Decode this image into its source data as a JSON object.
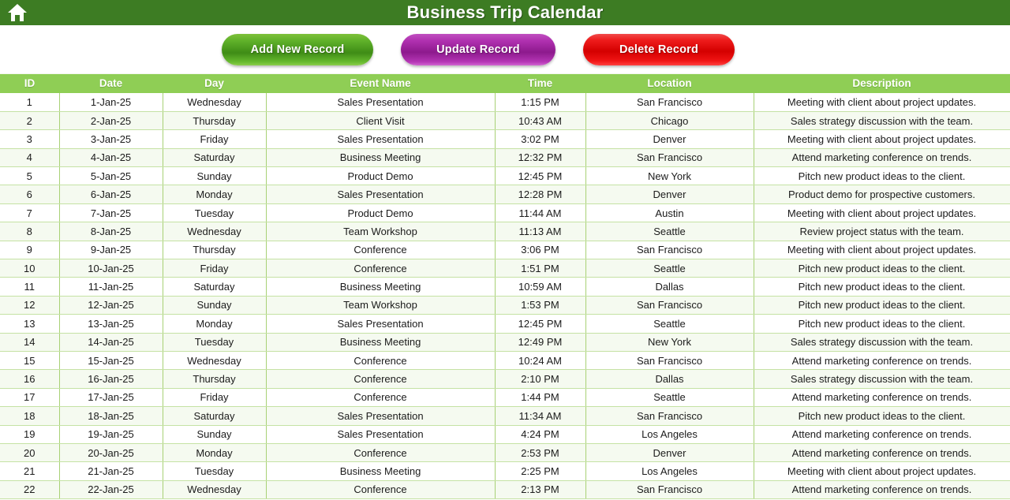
{
  "titlebar": {
    "home_icon": "home-icon",
    "title": "Business Trip Calendar",
    "bg_color": "#3d7c23"
  },
  "toolbar": {
    "add_label": "Add New Record",
    "update_label": "Update Record",
    "delete_label": "Delete Record",
    "add_color": "#3f8c16",
    "update_color": "#8d1a8d",
    "delete_color": "#d40000"
  },
  "table": {
    "header_bg": "#8fce55",
    "grid_color": "#a8d175",
    "columns": [
      "ID",
      "Date",
      "Day",
      "Event Name",
      "Time",
      "Location",
      "Description"
    ],
    "rows": [
      [
        "1",
        "1-Jan-25",
        "Wednesday",
        "Sales Presentation",
        "1:15 PM",
        "San Francisco",
        "Meeting with client about project updates."
      ],
      [
        "2",
        "2-Jan-25",
        "Thursday",
        "Client Visit",
        "10:43 AM",
        "Chicago",
        "Sales strategy discussion with the team."
      ],
      [
        "3",
        "3-Jan-25",
        "Friday",
        "Sales Presentation",
        "3:02 PM",
        "Denver",
        "Meeting with client about project updates."
      ],
      [
        "4",
        "4-Jan-25",
        "Saturday",
        "Business Meeting",
        "12:32 PM",
        "San Francisco",
        "Attend marketing conference on trends."
      ],
      [
        "5",
        "5-Jan-25",
        "Sunday",
        "Product Demo",
        "12:45 PM",
        "New York",
        "Pitch new product ideas to the client."
      ],
      [
        "6",
        "6-Jan-25",
        "Monday",
        "Sales Presentation",
        "12:28 PM",
        "Denver",
        "Product demo for prospective customers."
      ],
      [
        "7",
        "7-Jan-25",
        "Tuesday",
        "Product Demo",
        "11:44 AM",
        "Austin",
        "Meeting with client about project updates."
      ],
      [
        "8",
        "8-Jan-25",
        "Wednesday",
        "Team Workshop",
        "11:13 AM",
        "Seattle",
        "Review project status with the team."
      ],
      [
        "9",
        "9-Jan-25",
        "Thursday",
        "Conference",
        "3:06 PM",
        "San Francisco",
        "Meeting with client about project updates."
      ],
      [
        "10",
        "10-Jan-25",
        "Friday",
        "Conference",
        "1:51 PM",
        "Seattle",
        "Pitch new product ideas to the client."
      ],
      [
        "11",
        "11-Jan-25",
        "Saturday",
        "Business Meeting",
        "10:59 AM",
        "Dallas",
        "Pitch new product ideas to the client."
      ],
      [
        "12",
        "12-Jan-25",
        "Sunday",
        "Team Workshop",
        "1:53 PM",
        "San Francisco",
        "Pitch new product ideas to the client."
      ],
      [
        "13",
        "13-Jan-25",
        "Monday",
        "Sales Presentation",
        "12:45 PM",
        "Seattle",
        "Pitch new product ideas to the client."
      ],
      [
        "14",
        "14-Jan-25",
        "Tuesday",
        "Business Meeting",
        "12:49 PM",
        "New York",
        "Sales strategy discussion with the team."
      ],
      [
        "15",
        "15-Jan-25",
        "Wednesday",
        "Conference",
        "10:24 AM",
        "San Francisco",
        "Attend marketing conference on trends."
      ],
      [
        "16",
        "16-Jan-25",
        "Thursday",
        "Conference",
        "2:10 PM",
        "Dallas",
        "Sales strategy discussion with the team."
      ],
      [
        "17",
        "17-Jan-25",
        "Friday",
        "Conference",
        "1:44 PM",
        "Seattle",
        "Attend marketing conference on trends."
      ],
      [
        "18",
        "18-Jan-25",
        "Saturday",
        "Sales Presentation",
        "11:34 AM",
        "San Francisco",
        "Pitch new product ideas to the client."
      ],
      [
        "19",
        "19-Jan-25",
        "Sunday",
        "Sales Presentation",
        "4:24 PM",
        "Los Angeles",
        "Attend marketing conference on trends."
      ],
      [
        "20",
        "20-Jan-25",
        "Monday",
        "Conference",
        "2:53 PM",
        "Denver",
        "Attend marketing conference on trends."
      ],
      [
        "21",
        "21-Jan-25",
        "Tuesday",
        "Business Meeting",
        "2:25 PM",
        "Los Angeles",
        "Meeting with client about project updates."
      ],
      [
        "22",
        "22-Jan-25",
        "Wednesday",
        "Conference",
        "2:13 PM",
        "San Francisco",
        "Attend marketing conference on trends."
      ]
    ]
  }
}
